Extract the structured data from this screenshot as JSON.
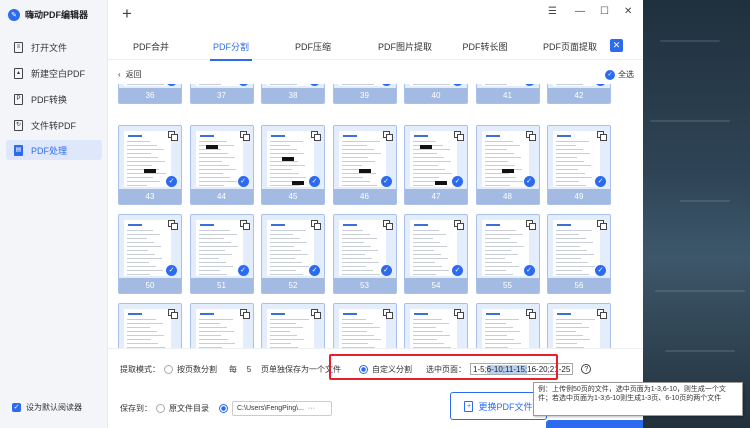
{
  "app": {
    "title": "嗨动PDF编辑器"
  },
  "sidebar": {
    "items": [
      {
        "label": "打开文件"
      },
      {
        "label": "新建空白PDF"
      },
      {
        "label": "PDF转换"
      },
      {
        "label": "文件转PDF"
      },
      {
        "label": "PDF处理"
      }
    ],
    "default_reader_label": "设为默认阅读器"
  },
  "titlebar": {
    "new_tab": "+",
    "menu": "☰",
    "minimize": "—",
    "maximize": "☐",
    "close": "✕"
  },
  "tabs": [
    {
      "label": "PDF合并"
    },
    {
      "label": "PDF分割"
    },
    {
      "label": "PDF压缩"
    },
    {
      "label": "PDF图片提取"
    },
    {
      "label": "PDF转长图"
    },
    {
      "label": "PDF页面提取"
    }
  ],
  "toolbar": {
    "back": "返回",
    "select_all": "全选"
  },
  "pages": {
    "rows": [
      [
        "36",
        "37",
        "38",
        "39",
        "40",
        "41",
        "42"
      ],
      [
        "43",
        "44",
        "45",
        "46",
        "47",
        "48",
        "49"
      ],
      [
        "50",
        "51",
        "52",
        "53",
        "54",
        "55",
        "56"
      ],
      [
        "",
        "",
        "",
        "",
        "",
        "",
        ""
      ]
    ]
  },
  "split": {
    "mode_label": "提取模式：",
    "by_pages_label": "按页数分割",
    "every_label": "每",
    "every_value": "5",
    "page_save_label": "页单独保存为一个文件",
    "custom_label": "自定义分割",
    "selected_pages_label": "选中页面：",
    "selected_pages_pre": "1-5;",
    "selected_pages_sel": "6-10;11-15;",
    "selected_pages_post": "16-20;21-25",
    "help": "?"
  },
  "save": {
    "label": "保存到：",
    "source_dir_label": "原文件目录",
    "path": "C:\\Users\\FengPing\\...",
    "path_more": "···"
  },
  "replace_button": "更换PDF文件",
  "tooltip": "例：上传例50页的文件，选中页面为1-3,6-10，则生成一个文件；若选中页面为1-3;6-10则生成1-3页、6-10页的两个文件",
  "colors": {
    "accent": "#2c6bf0",
    "highlight_border": "#e5202a"
  }
}
